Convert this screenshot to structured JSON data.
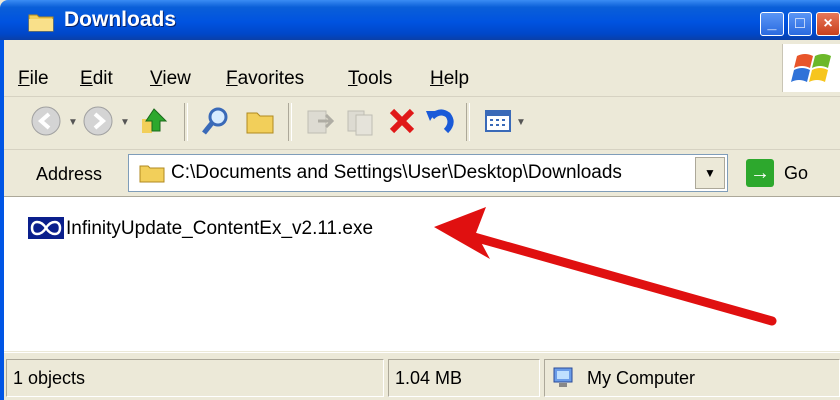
{
  "window": {
    "title": "Downloads"
  },
  "menu": {
    "items": [
      "File",
      "Edit",
      "View",
      "Favorites",
      "Tools",
      "Help"
    ]
  },
  "address": {
    "label": "Address",
    "path": "C:\\Documents and Settings\\User\\Desktop\\Downloads",
    "go_label": "Go"
  },
  "files": [
    {
      "name": "InfinityUpdate_ContentEx_v2.11.exe",
      "icon": "infinity-icon"
    }
  ],
  "status": {
    "objects": "1 objects",
    "size": "1.04 MB",
    "location": "My Computer"
  },
  "colors": {
    "titlebar": "#0053e0",
    "selection": "#0a1f8c",
    "arrow": "#e01010",
    "go": "#2da82d"
  }
}
